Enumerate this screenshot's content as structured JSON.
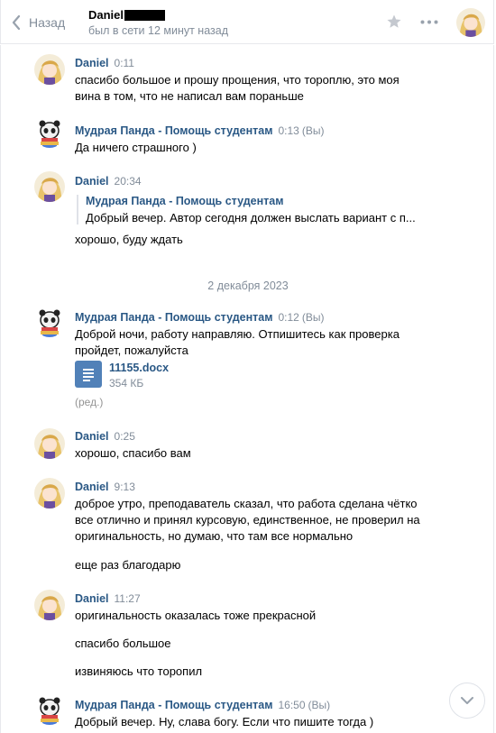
{
  "header": {
    "back_label": "Назад",
    "peer_name": "Daniel",
    "peer_status": "был в сети 12 минут назад"
  },
  "colors": {
    "link": "#2a5885",
    "muted": "#818c99",
    "file": "#5181b8"
  },
  "date_separator": "2 декабря 2023",
  "messages": [
    {
      "author": "Daniel",
      "time": "0:11",
      "lines": [
        "спасибо большое и прошу прощения, что тороплю, это моя",
        "вина в том, что не написал вам пораньше"
      ]
    },
    {
      "author": "Мудрая Панда - Помощь студентам",
      "time": "0:13",
      "you": "(Вы)",
      "lines": [
        "Да ничего страшного )"
      ]
    },
    {
      "author": "Daniel",
      "time": "20:34",
      "quote_author": "Мудрая Панда - Помощь студентам",
      "quote_text": "Добрый вечер. Автор сегодня должен выслать вариант с п...",
      "lines": [
        "хорошо, буду ждать"
      ]
    },
    {
      "author": "Мудрая Панда - Помощь студентам",
      "time": "0:12",
      "you": "(Вы)",
      "lines": [
        "Доброй ночи, работу направляю. Отпишитесь как проверка",
        "пройдет, пожалуйста"
      ],
      "file_name": "11155.docx",
      "file_size": "354 КБ",
      "edited": "(ред.)"
    },
    {
      "author": "Daniel",
      "time": "0:25",
      "lines": [
        "хорошо, спасибо вам"
      ]
    },
    {
      "author": "Daniel",
      "time": "9:13",
      "lines": [
        "доброе утро, преподаватель сказал, что работа сделана чётко",
        "все отлично и принял курсовую, единственное, не проверил на",
        "оригинальность, но думаю, что там все нормально"
      ],
      "extra": [
        "еще раз благодарю"
      ]
    },
    {
      "author": "Daniel",
      "time": "11:27",
      "lines": [
        "оригинальность оказалась тоже прекрасной"
      ],
      "extra": [
        "спасибо большое",
        "извиняюсь что торопил"
      ]
    },
    {
      "author": "Мудрая Панда - Помощь студентам",
      "time": "16:50",
      "you": "(Вы)",
      "lines": [
        "Добрый вечер. Ну, слава богу. Если что пишите тогда )"
      ]
    }
  ]
}
